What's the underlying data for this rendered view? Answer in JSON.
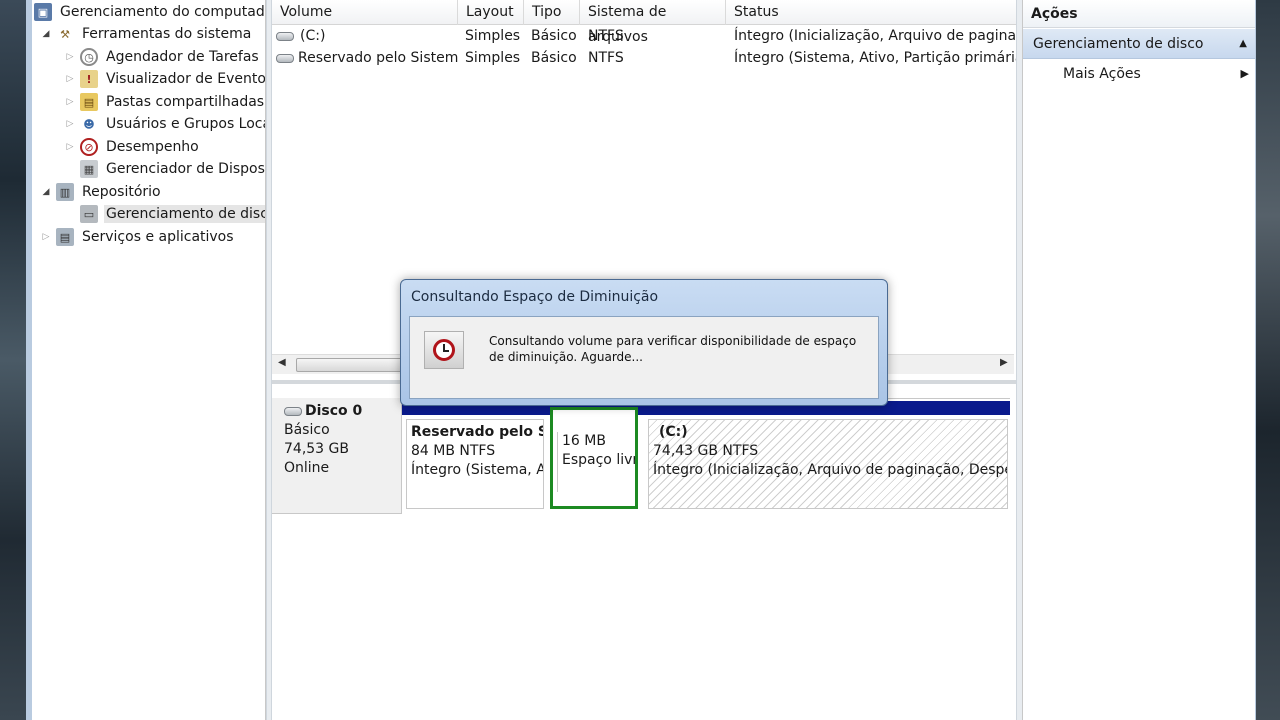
{
  "tree": {
    "root": "Gerenciamento do computador (Local)",
    "items": [
      {
        "label": "Ferramentas do sistema",
        "expander": "open",
        "icon": "tools-icon"
      },
      {
        "label": "Agendador de Tarefas",
        "expander": "closed",
        "icon": "clock-icon"
      },
      {
        "label": "Visualizador de Eventos",
        "expander": "closed",
        "icon": "event-viewer-icon"
      },
      {
        "label": "Pastas compartilhadas",
        "expander": "closed",
        "icon": "shared-folder-icon"
      },
      {
        "label": "Usuários e Grupos Locais",
        "expander": "closed",
        "icon": "users-icon"
      },
      {
        "label": "Desempenho",
        "expander": "closed",
        "icon": "performance-icon"
      },
      {
        "label": "Gerenciador de Dispositivos",
        "expander": "none",
        "icon": "device-manager-icon"
      },
      {
        "label": "Repositório",
        "expander": "open",
        "icon": "storage-icon"
      },
      {
        "label": "Gerenciamento de disco",
        "expander": "none",
        "icon": "disk-icon"
      },
      {
        "label": "Serviços e aplicativos",
        "expander": "closed",
        "icon": "services-icon"
      }
    ]
  },
  "volumes": {
    "columns": [
      "Volume",
      "Layout",
      "Tipo",
      "Sistema de arquivos",
      "Status"
    ],
    "rows": [
      {
        "volume": "(C:)",
        "layout": "Simples",
        "tipo": "Básico",
        "fs": "NTFS",
        "status": "Íntegro (Inicialização, Arquivo de paginação, Despejo de memória, Partição primária)"
      },
      {
        "volume": "Reservado pelo Sistema",
        "layout": "Simples",
        "tipo": "Básico",
        "fs": "NTFS",
        "status": "Íntegro (Sistema, Ativo, Partição primária)"
      }
    ]
  },
  "disk": {
    "name": "Disco 0",
    "type": "Básico",
    "size": "74,53 GB",
    "state": "Online",
    "partitions": [
      {
        "name": "Reservado pelo Sistema",
        "size": "84 MB NTFS",
        "status": "Íntegro (Sistema, Ativo, Partição primária)"
      },
      {
        "name": "",
        "size": "16 MB",
        "status": "Espaço livre"
      },
      {
        "name": "(C:)",
        "size": "74,43 GB NTFS",
        "status": "Íntegro (Inicialização, Arquivo de paginação, Despejo de memória)"
      }
    ]
  },
  "actions": {
    "title": "Ações",
    "section": "Gerenciamento de disco",
    "item": "Mais Ações"
  },
  "dialog": {
    "title": "Consultando Espaço de Diminuição",
    "message": "Consultando volume para verificar disponibilidade de espaço de diminuição. Aguarde..."
  },
  "colors": {
    "selection_border": "#1c8a22",
    "disk_bar": "#0a1a8c",
    "dialog_frame": "#a9c4e6"
  }
}
